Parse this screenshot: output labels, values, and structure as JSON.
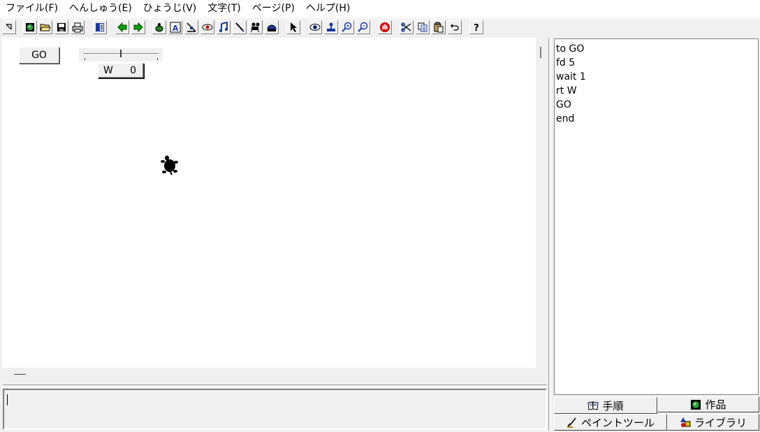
{
  "menu": [
    {
      "label": "ファイル(F)"
    },
    {
      "label": "へんしゅう(E)"
    },
    {
      "label": "ひょうじ(V)"
    },
    {
      "label": "文字(T)"
    },
    {
      "label": "ページ(P)"
    },
    {
      "label": "ヘルプ(H)"
    }
  ],
  "toolbar": {
    "buttons": [
      {
        "icon": "cursor-small-icon"
      },
      {
        "icon": "globe-icon"
      },
      {
        "icon": "open-folder-icon"
      },
      {
        "icon": "save-disk-icon"
      },
      {
        "icon": "printer-icon"
      },
      {
        "icon": "page-list-icon"
      },
      {
        "icon": "arrow-left-icon"
      },
      {
        "icon": "arrow-right-icon"
      },
      {
        "icon": "turtle-icon"
      },
      {
        "icon": "text-a-icon"
      },
      {
        "icon": "slider-tool-icon"
      },
      {
        "icon": "eye-oval-icon"
      },
      {
        "icon": "music-note-icon"
      },
      {
        "icon": "pen-icon"
      },
      {
        "icon": "film-camera-icon"
      },
      {
        "icon": "helmet-icon"
      },
      {
        "icon": "pointer-arrow-icon"
      },
      {
        "icon": "eye-icon"
      },
      {
        "icon": "stamp-icon"
      },
      {
        "icon": "zoom-in-icon"
      },
      {
        "icon": "zoom-out-icon"
      },
      {
        "icon": "stop-hand-icon"
      },
      {
        "icon": "scissors-icon"
      },
      {
        "icon": "copy-icon"
      },
      {
        "icon": "paste-icon"
      },
      {
        "icon": "undo-icon"
      },
      {
        "icon": "help-question-icon"
      }
    ]
  },
  "canvas": {
    "go_button_label": "GO",
    "slider": {
      "name": "W",
      "value": "0",
      "level_fraction": 0.5
    }
  },
  "procedures": {
    "lines": [
      "to GO",
      "fd 5",
      "wait 1",
      "rt W",
      "GO",
      "end"
    ]
  },
  "tabs": {
    "steps": "手順",
    "works": "作品",
    "paint": "ペイントツール",
    "library": "ライブラリ"
  },
  "colors": {
    "background": "#f0f0f0",
    "canvas": "#ffffff",
    "turtle": "#000000",
    "arrow_green": "#00a000"
  }
}
